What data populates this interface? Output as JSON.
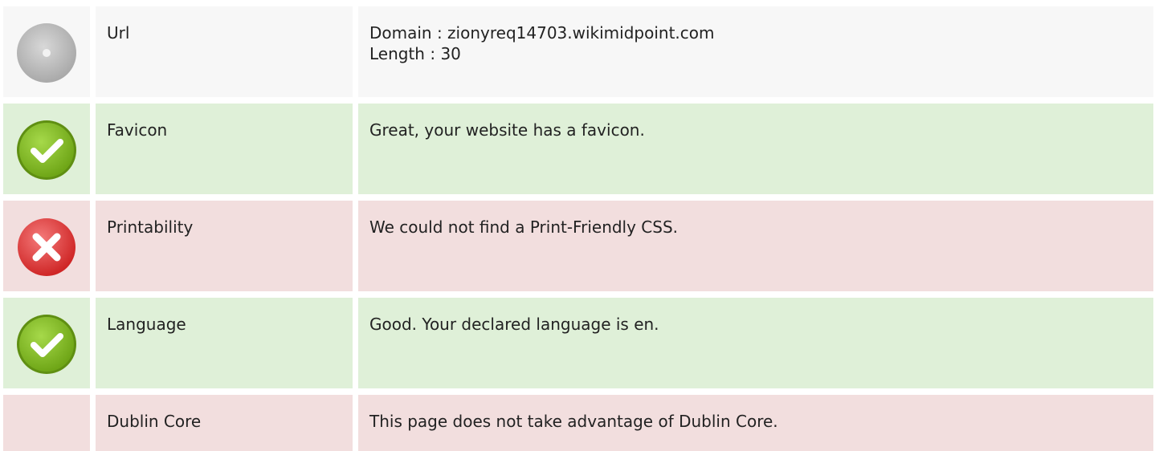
{
  "rows": [
    {
      "status": "neutral",
      "icon": "gray-disc-icon",
      "label": "Url",
      "lines": [
        "Domain : zionyreq14703.wikimidpoint.com",
        "Length : 30"
      ]
    },
    {
      "status": "good",
      "icon": "check-circle-icon",
      "label": "Favicon",
      "lines": [
        "Great, your website has a favicon."
      ]
    },
    {
      "status": "bad",
      "icon": "error-x-circle-icon",
      "label": "Printability",
      "lines": [
        "We could not find a Print-Friendly CSS."
      ]
    },
    {
      "status": "good",
      "icon": "check-circle-icon",
      "label": "Language",
      "lines": [
        "Good. Your declared language is en."
      ]
    },
    {
      "status": "bad",
      "icon": "",
      "label": "Dublin Core",
      "lines": [
        "This page does not take advantage of Dublin Core."
      ]
    }
  ],
  "colors": {
    "good_bg": "#dff0d8",
    "bad_bg": "#f2dede",
    "neutral_bg": "#f7f7f7",
    "good_icon": "#7cb518",
    "bad_icon": "#e23b3b",
    "neutral_icon": "#bdbdbd"
  }
}
